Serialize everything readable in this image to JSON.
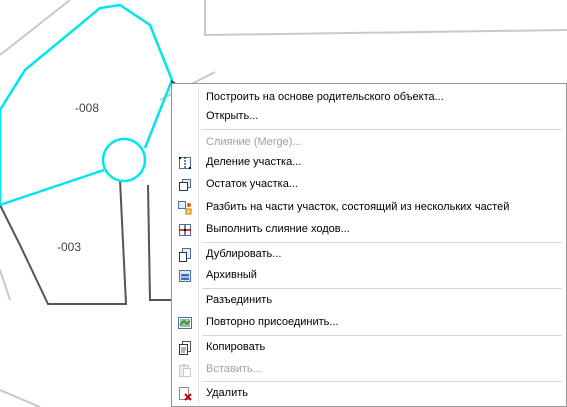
{
  "map": {
    "parcels": [
      {
        "id": "parcel-008",
        "label": "-008"
      },
      {
        "id": "parcel-003",
        "label": "-003"
      }
    ],
    "highlight_color": "#00e5ee",
    "boundary_color": "#555555",
    "background_line_color": "#c8c8c8"
  },
  "context_menu": {
    "items": [
      {
        "label": "Построить на основе родительского объекта...",
        "icon": "none",
        "enabled": true
      },
      {
        "label": "Открыть...",
        "icon": "none",
        "enabled": true
      },
      {
        "label": "Слияние (Merge)...",
        "icon": "none",
        "enabled": false
      },
      {
        "label": "Деление участка...",
        "icon": "divide-parcel-icon",
        "enabled": true
      },
      {
        "label": "Остаток участка...",
        "icon": "remainder-parcel-icon",
        "enabled": true
      },
      {
        "label": "Разбить на части участок, состоящий из нескольких частей",
        "icon": "explode-multipart-icon",
        "enabled": true
      },
      {
        "label": "Выполнить слияние ходов...",
        "icon": "merge-courses-icon",
        "enabled": true
      },
      {
        "label": "Дублировать...",
        "icon": "duplicate-icon",
        "enabled": true
      },
      {
        "label": "Архивный",
        "icon": "archive-icon",
        "enabled": true
      },
      {
        "label": "Разъединить",
        "icon": "none",
        "enabled": true
      },
      {
        "label": "Повторно присоединить...",
        "icon": "reattach-icon",
        "enabled": true
      },
      {
        "label": "Копировать",
        "icon": "copy-icon",
        "enabled": true
      },
      {
        "label": "Вставить...",
        "icon": "paste-icon",
        "enabled": false
      },
      {
        "label": "Удалить",
        "icon": "delete-icon",
        "enabled": true
      }
    ]
  }
}
